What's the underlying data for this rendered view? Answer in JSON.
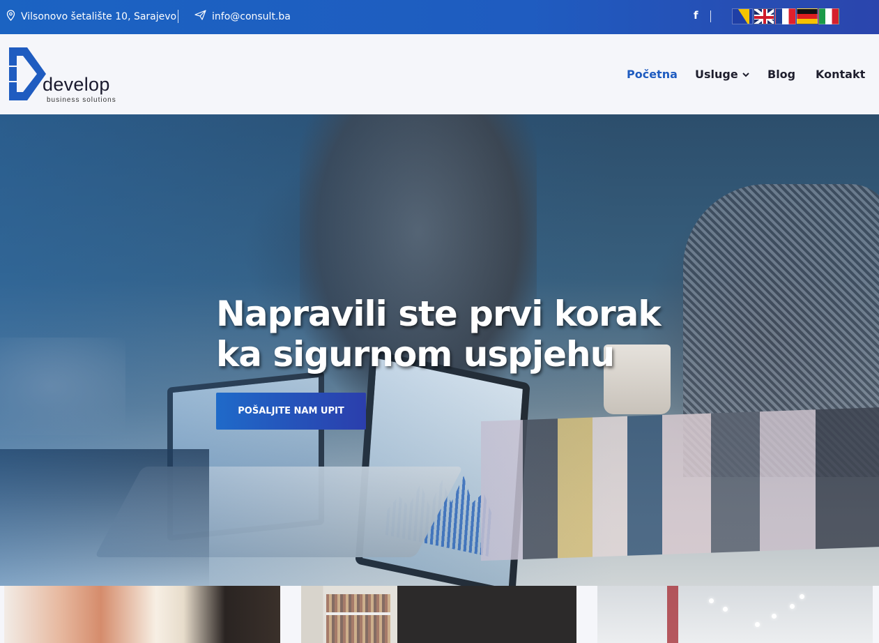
{
  "topbar": {
    "address": "Vilsonovo šetalište 10, Sarajevo",
    "email": "info@consult.ba",
    "social_icon": "facebook-icon",
    "languages": [
      "bs",
      "en",
      "fr",
      "de",
      "it"
    ]
  },
  "header": {
    "logo_word": "develop",
    "logo_tagline": "business solutions",
    "nav": [
      {
        "label": "Početna",
        "active": true
      },
      {
        "label": "Usluge",
        "has_dropdown": true
      },
      {
        "label": "Blog"
      },
      {
        "label": "Kontakt"
      }
    ]
  },
  "hero": {
    "title_line1": "Napravili ste prvi korak",
    "title_line2": "ka sigurnom uspjehu",
    "cta_label": "POŠALJITE NAM UPIT"
  },
  "colors": {
    "brand_blue": "#1f5cc0",
    "brand_indigo": "#2b3eac",
    "text_dark": "#1f1f2e"
  }
}
